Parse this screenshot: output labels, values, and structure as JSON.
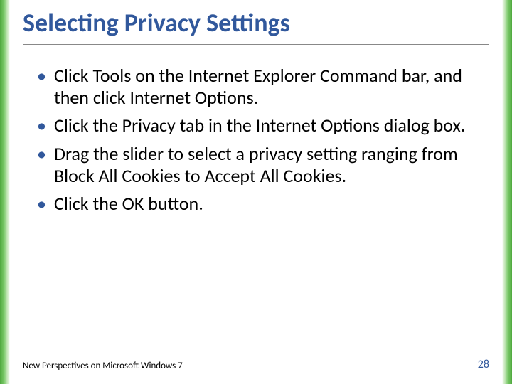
{
  "title": "Selecting Privacy Settings",
  "bullets": [
    "Click Tools on the Internet Explorer Command bar, and then click Internet Options.",
    "Click the Privacy tab in the Internet Options dialog box.",
    "Drag the slider to select a privacy setting ranging from Block All Cookies to Accept All Cookies.",
    "Click the OK button."
  ],
  "footer": {
    "text": "New Perspectives on Microsoft Windows 7",
    "page": "28"
  },
  "colors": {
    "accent": "#31589c",
    "border_green": "#4fa83e"
  }
}
